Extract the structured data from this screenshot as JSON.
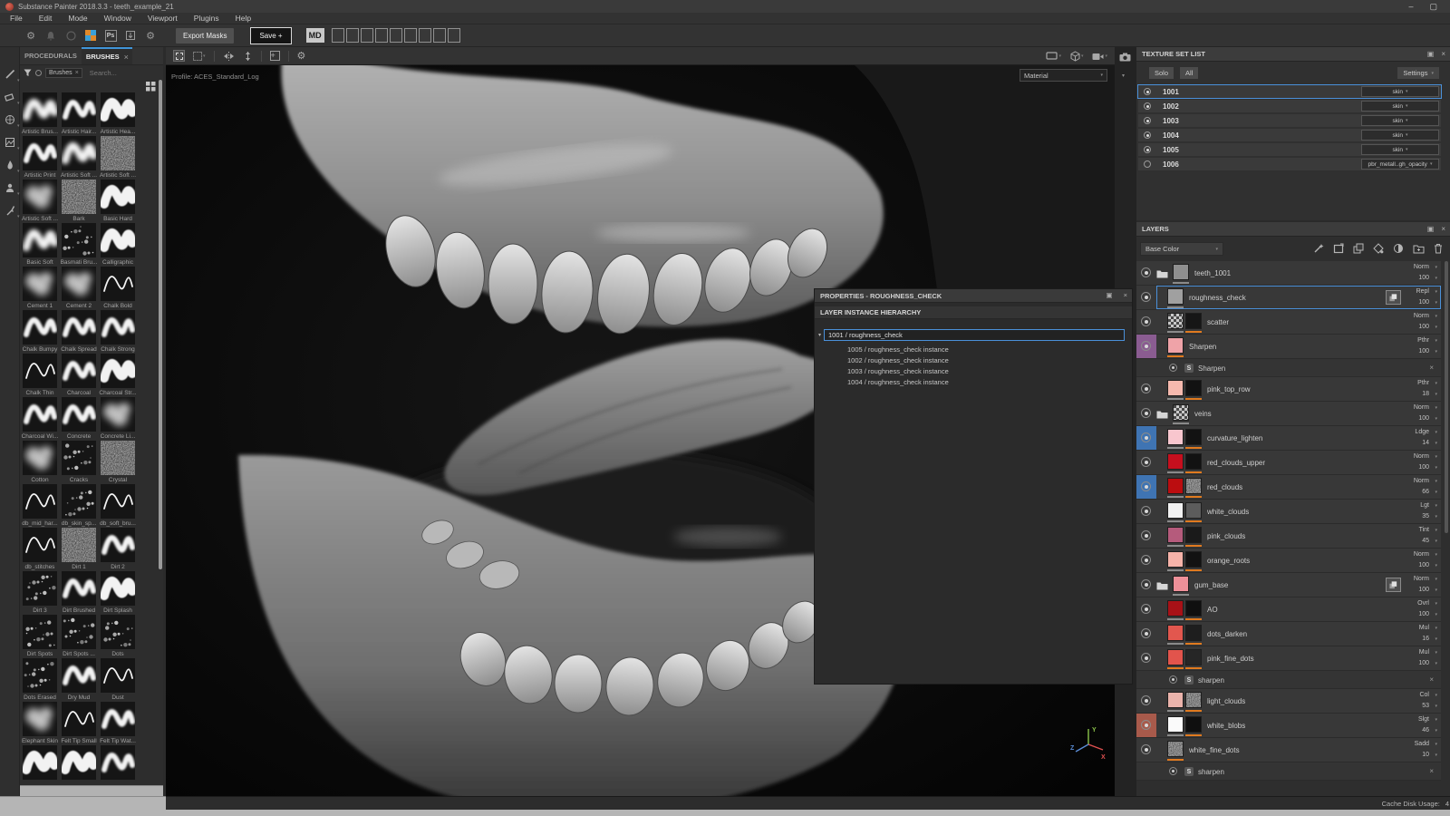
{
  "window": {
    "title": "Substance Painter 2018.3.3 - teeth_example_21"
  },
  "icons": {
    "close": "×",
    "chevron_down": "▾",
    "panel": "▣",
    "minimize": "–",
    "maximize": "▢",
    "effect_badge": "S",
    "photoshop_badge": "Ps",
    "gear": "⚙",
    "plus": "+"
  },
  "menu": {
    "items": [
      "File",
      "Edit",
      "Mode",
      "Window",
      "Viewport",
      "Plugins",
      "Help"
    ]
  },
  "toolbar": {
    "export_masks_label": "Export Masks",
    "save_label": "Save +",
    "md_label": "MD",
    "empty_slots": 9
  },
  "shelf": {
    "tabs": {
      "procedurals": "PROCEDURALS",
      "brushes": "BRUSHES"
    },
    "filter_chip": "Brushes",
    "search_placeholder": "Search...",
    "brushes": [
      {
        "n": "Artistic Brus...",
        "s": "wsoft"
      },
      {
        "n": "Artistic Hair...",
        "s": "w"
      },
      {
        "n": "Artistic Hea...",
        "s": "wbold"
      },
      {
        "n": "Artistic Print",
        "s": "w"
      },
      {
        "n": "Artistic Soft ...",
        "s": "wsoft"
      },
      {
        "n": "Artistic Soft ...",
        "s": "noise"
      },
      {
        "n": "Artistic Soft ...",
        "s": "blob"
      },
      {
        "n": "Bark",
        "s": "noise"
      },
      {
        "n": "Basic Hard",
        "s": "wbold"
      },
      {
        "n": "Basic Soft",
        "s": "wsoft"
      },
      {
        "n": "Basmati Bru...",
        "s": "dots"
      },
      {
        "n": "Calligraphic",
        "s": "wbold"
      },
      {
        "n": "Cement 1",
        "s": "blob"
      },
      {
        "n": "Cement 2",
        "s": "blob"
      },
      {
        "n": "Chalk Bold",
        "s": "wthin"
      },
      {
        "n": "Chalk Bumpy",
        "s": "w"
      },
      {
        "n": "Chalk Spread",
        "s": "w"
      },
      {
        "n": "Chalk Strong",
        "s": "w"
      },
      {
        "n": "Chalk Thin",
        "s": "wthin"
      },
      {
        "n": "Charcoal",
        "s": "w"
      },
      {
        "n": "Charcoal Str...",
        "s": "wbold"
      },
      {
        "n": "Charcoal Wi...",
        "s": "w"
      },
      {
        "n": "Concrete",
        "s": "w"
      },
      {
        "n": "Concrete Li...",
        "s": "blob"
      },
      {
        "n": "Cotton",
        "s": "blob"
      },
      {
        "n": "Cracks",
        "s": "dots"
      },
      {
        "n": "Crystal",
        "s": "noise"
      },
      {
        "n": "db_mid_har...",
        "s": "wthin"
      },
      {
        "n": "db_skin_sp...",
        "s": "dots"
      },
      {
        "n": "db_soft_bru...",
        "s": "wthin"
      },
      {
        "n": "db_stitches",
        "s": "wthin"
      },
      {
        "n": "Dirt 1",
        "s": "noise"
      },
      {
        "n": "Dirt 2",
        "s": "w"
      },
      {
        "n": "Dirt 3",
        "s": "dots"
      },
      {
        "n": "Dirt Brushed",
        "s": "w"
      },
      {
        "n": "Dirt Splash",
        "s": "wbold"
      },
      {
        "n": "Dirt Spots",
        "s": "dots"
      },
      {
        "n": "Dirt Spots ...",
        "s": "dots"
      },
      {
        "n": "Dots",
        "s": "dots"
      },
      {
        "n": "Dots Erased",
        "s": "dots"
      },
      {
        "n": "Dry Mud",
        "s": "w"
      },
      {
        "n": "Dust",
        "s": "wthin"
      },
      {
        "n": "Elephant Skin",
        "s": "blob"
      },
      {
        "n": "Felt Tip Small",
        "s": "wthin"
      },
      {
        "n": "Felt Tip Wat...",
        "s": "w"
      },
      {
        "n": "",
        "s": "wbold"
      },
      {
        "n": "",
        "s": "wbold"
      },
      {
        "n": "",
        "s": "w"
      }
    ]
  },
  "viewport": {
    "profile_label": "Profile: ACES_Standard_Log",
    "shading_mode": "Material",
    "axis": {
      "x": "X",
      "y": "Y",
      "z": "Z"
    }
  },
  "properties": {
    "title": "PROPERTIES - ROUGHNESS_CHECK",
    "section_title": "LAYER INSTANCE HIERARCHY",
    "root": "1001 / roughness_check",
    "instances": [
      "1005 / roughness_check instance",
      "1002 / roughness_check instance",
      "1003 / roughness_check instance",
      "1004 / roughness_check instance"
    ]
  },
  "texture_sets": {
    "title": "TEXTURE SET LIST",
    "solo_label": "Solo",
    "all_label": "All",
    "settings_label": "Settings",
    "sets": [
      {
        "id": "1001",
        "shader": "skin",
        "active": true,
        "selected": true
      },
      {
        "id": "1002",
        "shader": "skin",
        "active": true
      },
      {
        "id": "1003",
        "shader": "skin",
        "active": true
      },
      {
        "id": "1004",
        "shader": "skin",
        "active": true
      },
      {
        "id": "1005",
        "shader": "skin",
        "active": true
      },
      {
        "id": "1006",
        "shader": "pbr_metall..gh_opacity",
        "active": false
      }
    ]
  },
  "layers": {
    "title": "LAYERS",
    "channel_filter": "Base Color",
    "rows": [
      {
        "name": "teeth_1001",
        "folder": true,
        "t1": "#8f8f8f",
        "mode": "Norm",
        "op": "100",
        "u1": "grey"
      },
      {
        "name": "roughness_check",
        "t1": "#a0a0a0",
        "mode": "Repl",
        "op": "100",
        "u1": "grey",
        "sel": true,
        "copy": true
      },
      {
        "name": "scatter",
        "t1": "checker",
        "t2": "#161616",
        "mode": "Norm",
        "op": "100",
        "u1": "grey",
        "u2": "orange"
      },
      {
        "name": "Sharpen",
        "hl": "#8a5c91",
        "t1": "#efa3a8",
        "mode": "Pthr",
        "op": "100",
        "u1": "orange"
      },
      {
        "type": "effect",
        "name": "Sharpen"
      },
      {
        "name": "pink_top_row",
        "t1": "#f6b9ae",
        "t2": "#121212",
        "mode": "Pthr",
        "op": "18",
        "u1": "grey",
        "u2": "orange"
      },
      {
        "name": "veins",
        "folder": true,
        "t1": "checker",
        "mode": "Norm",
        "op": "100",
        "u1": "grey"
      },
      {
        "name": "curvature_lighten",
        "hl": "#3f74b3",
        "t1": "#f8c6ce",
        "t2": "#121212",
        "mode": "Ldge",
        "op": "14",
        "u1": "grey",
        "u2": "orange"
      },
      {
        "name": "red_clouds_upper",
        "t1": "#c60f1e",
        "t2": "#121212",
        "mode": "Norm",
        "op": "100",
        "u1": "grey",
        "u2": "orange"
      },
      {
        "name": "red_clouds",
        "hl": "#3f74b3",
        "t1": "#bb0d10",
        "t2": "noise",
        "mode": "Norm",
        "op": "66",
        "u1": "grey",
        "u2": "orange"
      },
      {
        "name": "white_clouds",
        "t1": "#f2f2f2",
        "t2": "#5c5c5c",
        "mode": "Lgt",
        "op": "35",
        "u1": "grey",
        "u2": "orange"
      },
      {
        "name": "pink_clouds",
        "t1": "#b55b7c",
        "t2": "#1a1a1a",
        "mode": "Tint",
        "op": "45",
        "u1": "grey",
        "u2": "orange"
      },
      {
        "name": "orange_roots",
        "t1": "#f6b3a9",
        "t2": "#121212",
        "mode": "Norm",
        "op": "100",
        "u1": "grey",
        "u2": "orange"
      },
      {
        "name": "gum_base",
        "folder": true,
        "t1": "#ee9099",
        "mode": "Norm",
        "op": "100",
        "u1": "grey",
        "copy": true
      },
      {
        "name": "AO",
        "t1": "#a81117",
        "t2": "#0f0f0f",
        "mode": "Ovrl",
        "op": "100",
        "u1": "grey",
        "u2": "orange"
      },
      {
        "name": "dots_darken",
        "t1": "#e2574e",
        "t2": "#1e1e1e",
        "mode": "Mul",
        "op": "16",
        "u1": "grey",
        "u2": "orange"
      },
      {
        "name": "pink_fine_dots",
        "t1": "#e2544c",
        "t2": "#262626",
        "mode": "Mul",
        "op": "100",
        "u1": "orange",
        "u2": "orange"
      },
      {
        "type": "effect",
        "name": "sharpen"
      },
      {
        "name": "light_clouds",
        "t1": "#eab3ab",
        "t2": "noise",
        "mode": "Col",
        "op": "53",
        "u1": "grey",
        "u2": "orange"
      },
      {
        "name": "white_blobs",
        "hl": "#a85a4b",
        "t1": "#fafafa",
        "t2": "#0f0f0f",
        "mode": "Slgt",
        "op": "46",
        "u1": "grey",
        "u2": "orange"
      },
      {
        "name": "white_fine_dots",
        "t1": "noise",
        "mode": "Sadd",
        "op": "10",
        "u1": "orange"
      },
      {
        "type": "effect",
        "name": "sharpen"
      }
    ]
  },
  "status": {
    "cache_label": "Cache Disk Usage:",
    "cache_value": "4"
  },
  "colors": {
    "accent": "#4a90d9",
    "orange": "#e07a1f",
    "grey_bar": "#8a8a8a"
  }
}
